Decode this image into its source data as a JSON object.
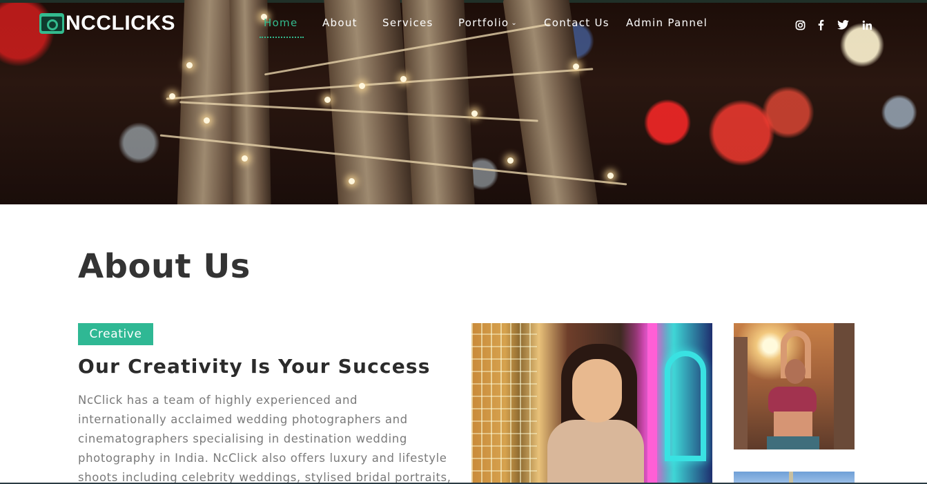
{
  "brand": {
    "name": "NCCLICKS"
  },
  "nav": {
    "items": [
      {
        "label": "Home",
        "active": true
      },
      {
        "label": "About"
      },
      {
        "label": "Services"
      },
      {
        "label": "Portfolio",
        "has_dropdown": true
      },
      {
        "label": "Contact Us"
      },
      {
        "label": "Admin Pannel"
      }
    ]
  },
  "social": [
    {
      "icon": "instagram-icon"
    },
    {
      "icon": "facebook-icon"
    },
    {
      "icon": "twitter-icon"
    },
    {
      "icon": "linkedin-icon"
    }
  ],
  "about": {
    "title": "About Us",
    "tag": "Creative",
    "subtitle": "Our Creativity Is Your Success",
    "paragraph_lines": [
      "NcClick has a team of highly experienced and",
      "internationally acclaimed wedding photographers and",
      "cinematographers specialising in destination wedding",
      "photography in India. NcClick also offers luxury and lifestyle",
      "shoots including celebrity weddings, stylised bridal portraits,"
    ]
  },
  "colors": {
    "accent": "#2fb894",
    "title_text": "#333333",
    "body_text": "#7a7a7a",
    "nav_text": "#ffffff"
  }
}
